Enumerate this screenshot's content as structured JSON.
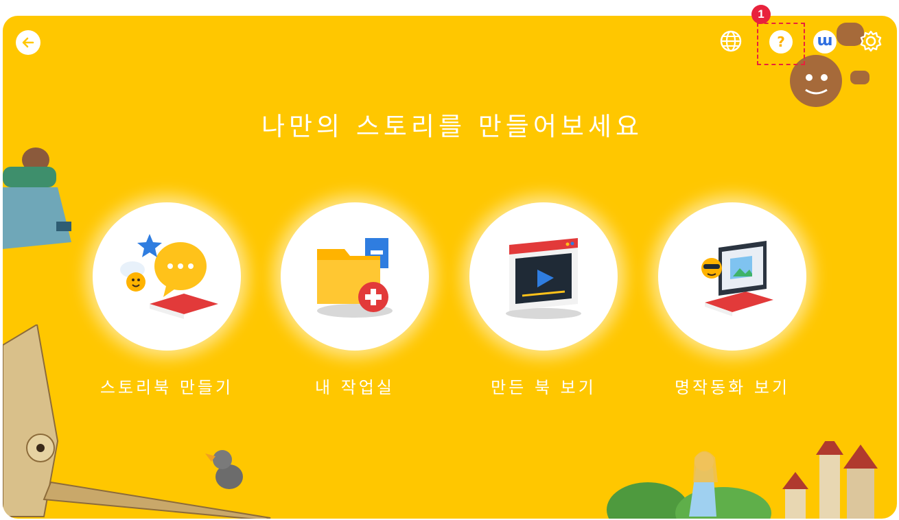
{
  "header": {
    "back_icon": "arrow-left-icon",
    "icons": [
      "globe-icon",
      "help-icon",
      "w-logo-icon",
      "gear-icon"
    ],
    "help_label": "?",
    "w_label": "ɯ",
    "marker_label": "1"
  },
  "main": {
    "title": "나만의 스토리를 만들어보세요",
    "menu": [
      {
        "label": "스토리북 만들기",
        "icon": "storybook-create-icon"
      },
      {
        "label": "내 작업실",
        "icon": "my-workroom-folder-icon"
      },
      {
        "label": "만든 북 보기",
        "icon": "video-player-icon"
      },
      {
        "label": "명작동화 보기",
        "icon": "monitor-gallery-icon"
      }
    ]
  },
  "colors": {
    "background": "#FFC700",
    "accent_red": "#E8223C",
    "white": "#FFFFFF",
    "help_yellow": "#FFB300",
    "brand_blue": "#2F6FE0"
  }
}
